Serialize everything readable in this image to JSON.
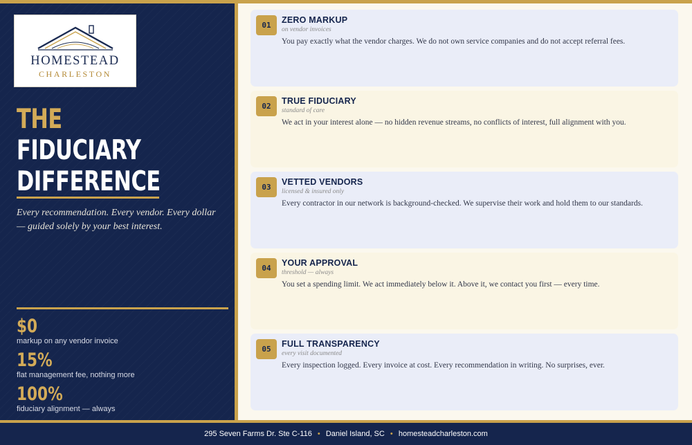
{
  "brand": {
    "name": "HOMESTEAD",
    "city": "CHARLESTON"
  },
  "hero": {
    "title_line1": "THE",
    "title_line2": "FIDUCIARY",
    "title_line3": "DIFFERENCE",
    "tagline": "Every recommendation. Every vendor. Every dollar — guided solely by your best interest."
  },
  "stats": [
    {
      "value": "$0",
      "label": "markup on any vendor invoice"
    },
    {
      "value": "15%",
      "label": "flat management fee, nothing more"
    },
    {
      "value": "100%",
      "label": "fiduciary alignment — always"
    }
  ],
  "cards": [
    {
      "number": "01",
      "title": "ZERO MARKUP",
      "subtitle": "on vendor invoices",
      "body": "You pay exactly what the vendor charges. We do not own service companies and do not accept referral fees."
    },
    {
      "number": "02",
      "title": "TRUE FIDUCIARY",
      "subtitle": "standard of care",
      "body": "We act in your interest alone — no hidden revenue streams, no conflicts of interest, full alignment with you."
    },
    {
      "number": "03",
      "title": "VETTED VENDORS",
      "subtitle": "licensed & insured only",
      "body": "Every contractor in our network is background-checked. We supervise their work and hold them to our standards."
    },
    {
      "number": "04",
      "title": "YOUR APPROVAL",
      "subtitle": "threshold — always",
      "body": "You set a spending limit. We act immediately below it. Above it, we contact you first — every time."
    },
    {
      "number": "05",
      "title": "FULL TRANSPARENCY",
      "subtitle": "every visit documented",
      "body": "Every inspection logged. Every invoice at cost. Every recommendation in writing. No surprises, ever."
    }
  ],
  "footer": {
    "address": "295 Seven Farms Dr. Ste C-116",
    "location": "Daniel Island, SC",
    "website": "homesteadcharleston.com",
    "separator": "•"
  },
  "colors": {
    "navy": "#15254d",
    "gold": "#c9a24c",
    "card_blue": "#eaedf8",
    "card_cream": "#faf5e4"
  }
}
